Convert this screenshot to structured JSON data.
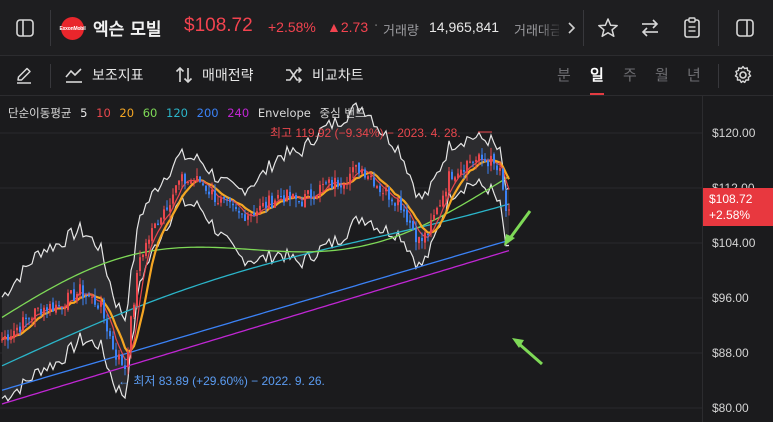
{
  "header": {
    "logo_text": "ExxonMobil",
    "stock_name": "엑슨 모빌",
    "price": "$108.72",
    "change_pct": "+2.58%",
    "change_abs": "▲2.73",
    "separator": "·",
    "volume_label": "거래량",
    "volume_value": "14,965,841",
    "amount_label": "거래대금",
    "icons": [
      "sidebar-toggle-icon",
      "chevron-right-icon",
      "star-icon",
      "swap-icon",
      "clipboard-icon",
      "panel-toggle-icon"
    ]
  },
  "toolbar": {
    "draw_icon": "pencil-icon",
    "indicators_label": "보조지표",
    "strategy_label": "매매전략",
    "compare_label": "비교차트",
    "periods": [
      "분",
      "일",
      "주",
      "월",
      "년"
    ],
    "active_period": "일",
    "settings_icon": "gear-icon"
  },
  "legend": {
    "ma_label": "단순이동평균",
    "ma_periods": [
      {
        "value": "5",
        "color": "#e9e9e9"
      },
      {
        "value": "10",
        "color": "#e8474d"
      },
      {
        "value": "20",
        "color": "#f5a623"
      },
      {
        "value": "60",
        "color": "#7ed957"
      },
      {
        "value": "120",
        "color": "#2bb5c9"
      },
      {
        "value": "200",
        "color": "#3b82f6"
      },
      {
        "value": "240",
        "color": "#c026d3"
      }
    ],
    "envelope_label": "Envelope",
    "band_label": "중심 밴드"
  },
  "annotations": {
    "high": "최고 119.92 (−9.34%) − 2023. 4. 28.",
    "low": "최저 83.89 (+29.60%) − 2022. 9. 26."
  },
  "price_axis": {
    "ticks": [
      "$120.00",
      "$112.00",
      "$104.00",
      "$96.00",
      "$88.00",
      "$80.00"
    ],
    "current_price": "$108.72",
    "current_change": "+2.58%"
  },
  "colors": {
    "up": "#e8474d",
    "down": "#3b82f6",
    "price_tag": "#e8383f",
    "arrow": "#7ed957"
  },
  "chart_data": {
    "type": "candlestick",
    "ylim": [
      80,
      122
    ],
    "y_ticks": [
      80,
      88,
      96,
      104,
      112,
      120
    ],
    "high": {
      "value": 119.92,
      "date": "2023. 4. 28."
    },
    "low": {
      "value": 83.89,
      "date": "2022. 9. 26."
    },
    "last_close": 108.72,
    "series": [
      {
        "name": "5",
        "color": "#e9e9e9"
      },
      {
        "name": "10",
        "color": "#e8474d"
      },
      {
        "name": "20",
        "color": "#f5a623"
      },
      {
        "name": "60",
        "color": "#7ed957"
      },
      {
        "name": "120",
        "color": "#2bb5c9"
      },
      {
        "name": "200",
        "color": "#3b82f6"
      },
      {
        "name": "240",
        "color": "#c026d3"
      }
    ]
  }
}
